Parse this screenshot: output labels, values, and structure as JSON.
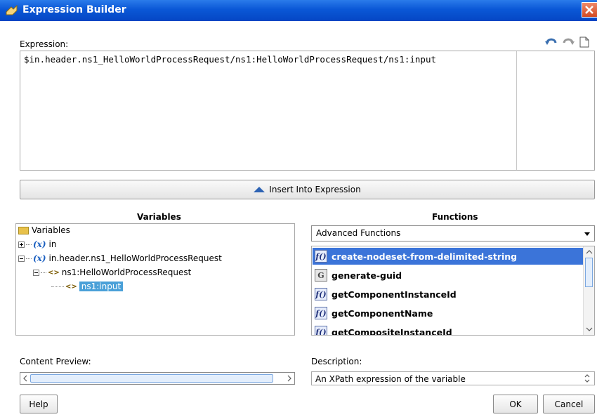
{
  "window": {
    "title": "Expression Builder"
  },
  "expression": {
    "label": "Expression:",
    "value": "$in.header.ns1_HelloWorldProcessRequest/ns1:HelloWorldProcessRequest/ns1:input"
  },
  "toolbar": {
    "icons": [
      "undo-icon",
      "redo-icon",
      "new-document-icon"
    ]
  },
  "insert_button": {
    "label": "Insert Into Expression"
  },
  "variables": {
    "title": "Variables",
    "tree": [
      {
        "label": "Variables",
        "icon": "folder-icon"
      },
      {
        "label": "in",
        "icon": "variable-icon",
        "expander": "+"
      },
      {
        "label": "in.header.ns1_HelloWorldProcessRequest",
        "icon": "variable-icon",
        "expander": "-"
      },
      {
        "label": "ns1:HelloWorldProcessRequest",
        "icon": "element-icon",
        "expander": "-"
      },
      {
        "label": "ns1:input",
        "icon": "element-icon",
        "selected": true
      }
    ]
  },
  "functions": {
    "title": "Functions",
    "category": "Advanced Functions",
    "items": [
      {
        "label": "create-nodeset-from-delimited-string",
        "icon": "function-icon",
        "selected": true
      },
      {
        "label": "generate-guid",
        "icon": "generator-icon"
      },
      {
        "label": "getComponentInstanceId",
        "icon": "function-icon"
      },
      {
        "label": "getComponentName",
        "icon": "function-icon"
      },
      {
        "label": "getCompositeInstanceId",
        "icon": "function-icon"
      }
    ]
  },
  "content_preview": {
    "label": "Content Preview:"
  },
  "description": {
    "label": "Description:",
    "value": "An XPath expression of the variable"
  },
  "buttons": {
    "help": "Help",
    "ok": "OK",
    "cancel": "Cancel"
  },
  "colors": {
    "title_bar": "#0a57d6",
    "selection": "#3b74d9",
    "tree_selection": "#4aa0d8"
  }
}
